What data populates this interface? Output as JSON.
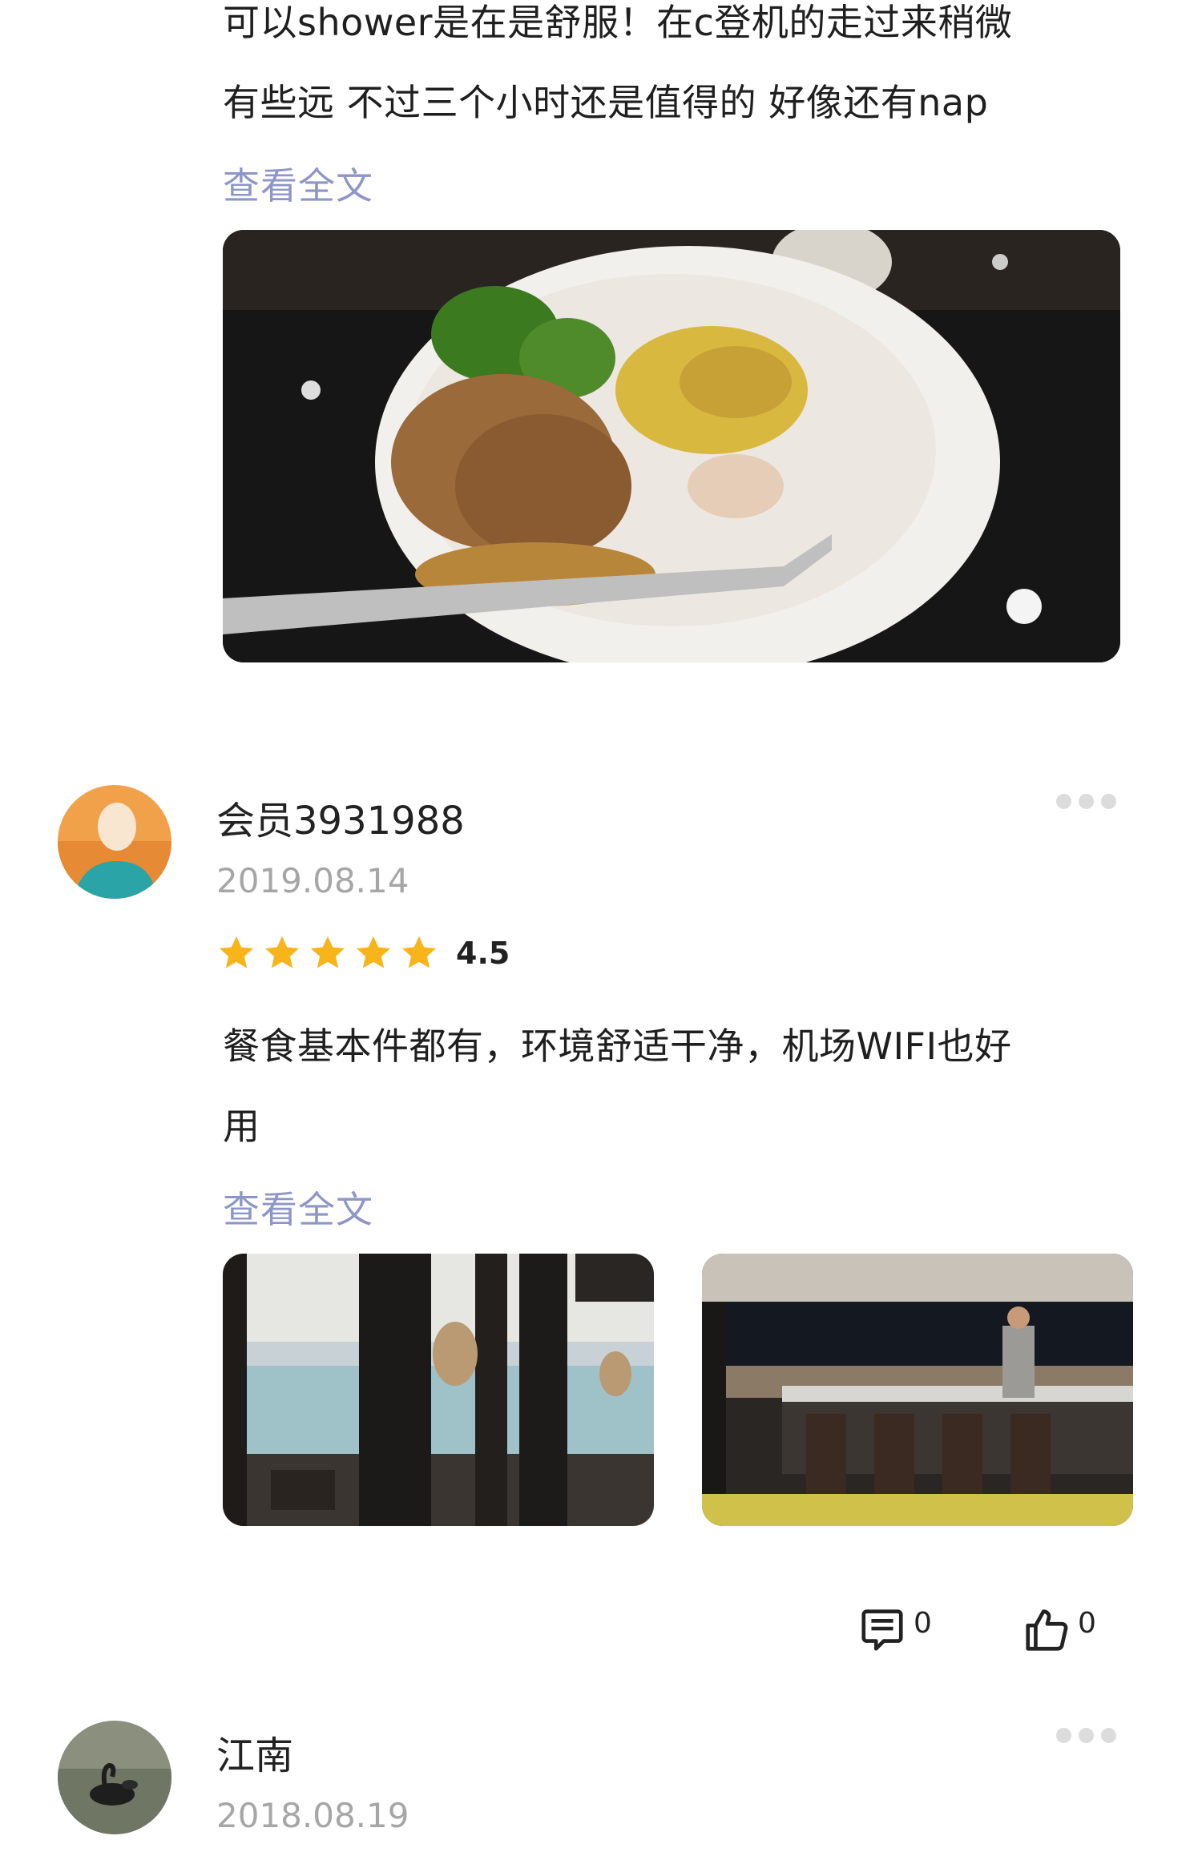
{
  "review1": {
    "text_line1": "可以shower是在是舒服！在c登机的走过来稍微",
    "text_line2": "有些远 不过三个小时还是值得的 好像还有nap",
    "more_link": "查看全文"
  },
  "review2": {
    "username": "会员3931988",
    "date": "2019.08.14",
    "rating": "4.5",
    "stars_filled": 5,
    "text_line1": "餐食基本件都有，环境舒适干净，机场WIFI也好",
    "text_line2": "用",
    "more_link": "查看全文",
    "comment_count": "0",
    "like_count": "0"
  },
  "review3": {
    "username": "江南",
    "date": "2018.08.19"
  },
  "colors": {
    "link": "#8e96c8",
    "star": "#f7b51b",
    "muted": "#a6a6a6"
  },
  "icons": [
    "more-dots-icon",
    "star-icon",
    "comment-icon",
    "thumbs-up-icon"
  ]
}
